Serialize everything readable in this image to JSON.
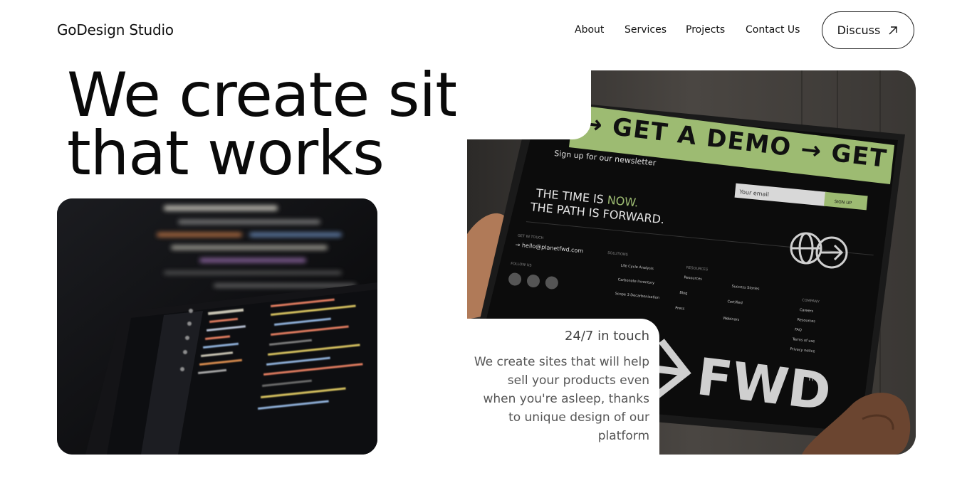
{
  "brand": "GoDesign Studio",
  "nav": {
    "items": [
      "About",
      "Services",
      "Projects",
      "Contact Us"
    ],
    "cta": "Discuss"
  },
  "hero": {
    "line1": "We create sites",
    "line2": "that works",
    "tagline": "24/7 in touch",
    "description": "We create sites that will help sell your products even when you're asleep, thanks to unique design of our platform"
  },
  "tablet_screen": {
    "banner": "→ GET A DEMO → GET",
    "newsletter": "Sign up for our newsletter",
    "email_placeholder": "Your email",
    "signup": "SIGN UP",
    "time_line1_a": "THE TIME IS ",
    "time_line1_b": "NOW.",
    "time_line2": "THE PATH IS FORWARD.",
    "get_in_touch": "GET IN TOUCH",
    "email": "→ hello@planetfwd.com",
    "follow_us": "FOLLOW US",
    "solutions": "SOLUTIONS",
    "sol_items": [
      "Life Cycle Analysis",
      "Carbonate Inventory",
      "Scope 3 Decarbonization"
    ],
    "resources": "RESOURCES",
    "res_items": [
      "Resources",
      "Blog",
      "Press"
    ],
    "stories": [
      "Success Stories",
      "Certified",
      "Webinars"
    ],
    "company": "COMPANY",
    "company_items": [
      "Careers",
      "Resources",
      "FAQ",
      "Terms of use",
      "Privacy notice"
    ],
    "logo": "FWD",
    "tm": "TM",
    "accent": "#9dbb72"
  }
}
